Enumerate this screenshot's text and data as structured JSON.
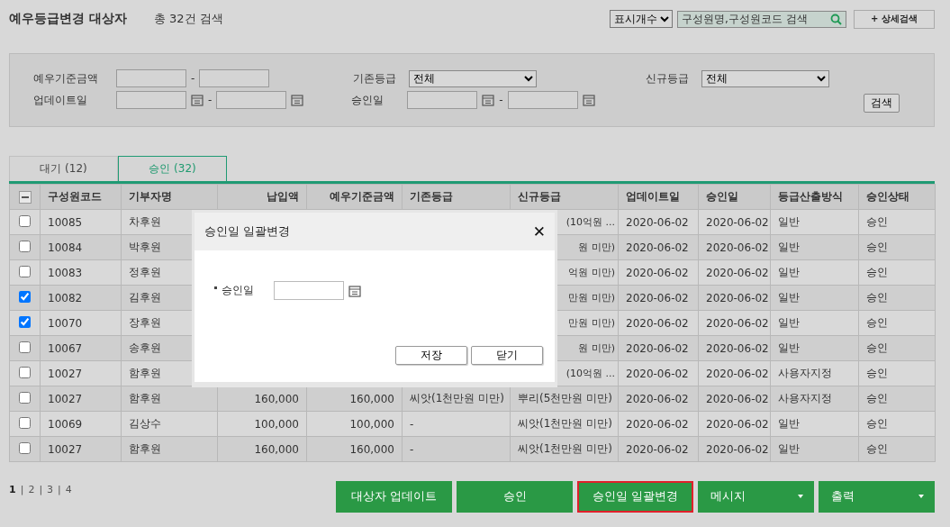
{
  "header": {
    "title": "예우등급변경 대상자",
    "count": "총 32건 검색",
    "display_select": "표시개수",
    "search": {
      "placeholder": "구성원명,구성원코드 검색"
    },
    "detail_button": "+ 상세검색"
  },
  "filters": {
    "base_amount_label": "예우기준금액",
    "range_dash_1": "-",
    "old_grade_label": "기존등급",
    "old_grade_value": "전체",
    "new_grade_label": "신규등급",
    "new_grade_value": "전체",
    "updated_label": "업데이트일",
    "range_dash_2": "-",
    "approved_label": "승인일",
    "range_dash_3": "-",
    "search_button": "검색"
  },
  "tabs": [
    {
      "label": "대기 (12)",
      "selected": false
    },
    {
      "label": "승인 (32)",
      "selected": true
    }
  ],
  "table": {
    "select_all_partial": true,
    "columns": [
      "구성원코드",
      "기부자명",
      "납입액",
      "예우기준금액",
      "기존등급",
      "신규등급",
      "업데이트일",
      "승인일",
      "등급산출방식",
      "승인상태"
    ],
    "rows": [
      {
        "checked": false,
        "code": "10085",
        "donor": "차후원",
        "new_grade": "(10억원 ...",
        "updated": "2020-06-02",
        "approved": "2020-06-02",
        "method": "일반",
        "status": "승인"
      },
      {
        "checked": false,
        "code": "10084",
        "donor": "박후원",
        "new_grade": "원 미만)",
        "updated": "2020-06-02",
        "approved": "2020-06-02",
        "method": "일반",
        "status": "승인"
      },
      {
        "checked": false,
        "code": "10083",
        "donor": "정후원",
        "new_grade": "억원 미만)",
        "updated": "2020-06-02",
        "approved": "2020-06-02",
        "method": "일반",
        "status": "승인"
      },
      {
        "checked": true,
        "code": "10082",
        "donor": "김후원",
        "new_grade": "만원 미만)",
        "updated": "2020-06-02",
        "approved": "2020-06-02",
        "method": "일반",
        "status": "승인"
      },
      {
        "checked": true,
        "code": "10070",
        "donor": "장후원",
        "new_grade": "만원 미만)",
        "updated": "2020-06-02",
        "approved": "2020-06-02",
        "method": "일반",
        "status": "승인"
      },
      {
        "checked": false,
        "code": "10067",
        "donor": "송후원",
        "new_grade": "원 미만)",
        "updated": "2020-06-02",
        "approved": "2020-06-02",
        "method": "일반",
        "status": "승인"
      },
      {
        "checked": false,
        "code": "10027",
        "donor": "함후원",
        "new_grade": "(10억원 ...",
        "updated": "2020-06-02",
        "approved": "2020-06-02",
        "method": "사용자지정",
        "status": "승인"
      },
      {
        "checked": false,
        "code": "10027",
        "donor": "함후원",
        "paid": "160,000",
        "base": "160,000",
        "old_grade": "씨앗(1천만원 미만)",
        "new_grade": "뿌리(5천만원 미만)",
        "updated": "2020-06-02",
        "approved": "2020-06-02",
        "method": "사용자지정",
        "status": "승인"
      },
      {
        "checked": false,
        "code": "10069",
        "donor": "김상수",
        "paid": "100,000",
        "base": "100,000",
        "old_grade": "-",
        "new_grade": "씨앗(1천만원 미만)",
        "updated": "2020-06-02",
        "approved": "2020-06-02",
        "method": "일반",
        "status": "승인"
      },
      {
        "checked": false,
        "code": "10027",
        "donor": "함후원",
        "paid": "160,000",
        "base": "160,000",
        "old_grade": "-",
        "new_grade": "씨앗(1천만원 미만)",
        "updated": "2020-06-02",
        "approved": "2020-06-02",
        "method": "일반",
        "status": "승인"
      }
    ]
  },
  "pagination": {
    "separator": "|",
    "pages": [
      {
        "label": "1",
        "selected": true
      },
      {
        "label": "2",
        "selected": false
      },
      {
        "label": "3",
        "selected": false
      },
      {
        "label": "4",
        "selected": false
      }
    ]
  },
  "actions": [
    {
      "label": "대상자 업데이트",
      "kind": "plain",
      "outlined": false
    },
    {
      "label": "승인",
      "kind": "plain",
      "outlined": false
    },
    {
      "label": "승인일 일괄변경",
      "kind": "plain",
      "outlined": true
    },
    {
      "label": "메시지",
      "kind": "dropdown",
      "outlined": false
    },
    {
      "label": "출력",
      "kind": "dropdown",
      "outlined": false
    }
  ],
  "dialog": {
    "title": "승인일 일괄변경",
    "close": "✕",
    "field_label": "승인일",
    "buttons": [
      "저장",
      "닫기"
    ]
  }
}
